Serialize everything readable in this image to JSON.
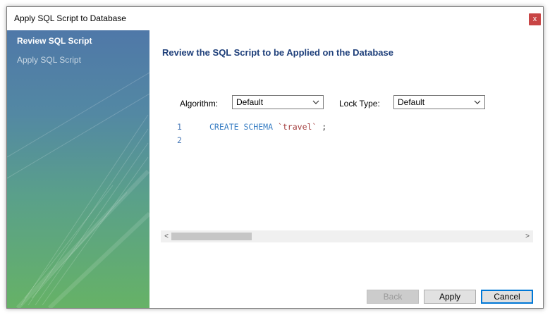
{
  "window": {
    "title": "Apply SQL Script to Database",
    "close_glyph": "x"
  },
  "sidebar": {
    "items": [
      {
        "label": "Review SQL Script",
        "active": true
      },
      {
        "label": "Apply SQL Script",
        "active": false
      }
    ]
  },
  "main": {
    "heading": "Review the SQL Script to be Applied on the Database",
    "algorithm": {
      "label": "Algorithm:",
      "value": "Default"
    },
    "lock_type": {
      "label": "Lock Type:",
      "value": "Default"
    },
    "script": {
      "lines": [
        {
          "number": "1",
          "keyword": "CREATE SCHEMA",
          "identifier": "`travel`",
          "terminator": ";"
        },
        {
          "number": "2",
          "keyword": "",
          "identifier": "",
          "terminator": ""
        }
      ]
    },
    "scroll_left": "<",
    "scroll_right": ">"
  },
  "buttons": {
    "back": "Back",
    "apply": "Apply",
    "cancel": "Cancel"
  },
  "colors": {
    "heading": "#1e3f7a",
    "keyword": "#3a7fc4",
    "identifier": "#a33d3d",
    "close": "#c84545"
  }
}
